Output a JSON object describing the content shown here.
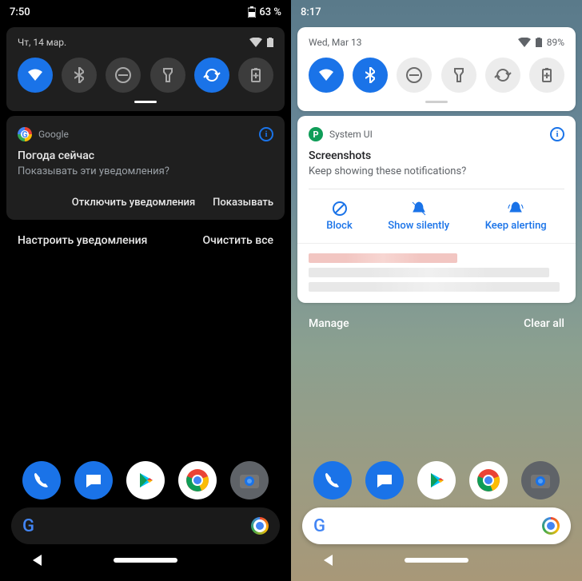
{
  "left": {
    "status": {
      "time": "7:50",
      "battery": "63 %"
    },
    "qs": {
      "date": "Чт, 14 мар.",
      "tiles": [
        {
          "name": "wifi",
          "on": true
        },
        {
          "name": "bluetooth",
          "on": false
        },
        {
          "name": "dnd",
          "on": false
        },
        {
          "name": "flashlight",
          "on": false
        },
        {
          "name": "autorotate",
          "on": true
        },
        {
          "name": "battery-saver",
          "on": false
        }
      ]
    },
    "notif": {
      "app": "Google",
      "title": "Погода сейчас",
      "body": "Показывать эти уведомления?",
      "action_deny": "Отключить уведомления",
      "action_allow": "Показывать"
    },
    "footer": {
      "manage": "Настроить уведомления",
      "clear": "Очистить все"
    },
    "dock": [
      "phone",
      "messages",
      "play",
      "chrome",
      "camera"
    ]
  },
  "right": {
    "status": {
      "time": "8:17",
      "battery": "89%"
    },
    "qs": {
      "date": "Wed, Mar 13",
      "tiles": [
        {
          "name": "wifi",
          "on": true
        },
        {
          "name": "bluetooth",
          "on": true
        },
        {
          "name": "dnd",
          "on": false
        },
        {
          "name": "flashlight",
          "on": false
        },
        {
          "name": "autorotate",
          "on": false
        },
        {
          "name": "battery-saver",
          "on": false
        }
      ]
    },
    "notif": {
      "app": "System UI",
      "title": "Screenshots",
      "body": "Keep showing these notifications?",
      "action_block": "Block",
      "action_silent": "Show silently",
      "action_alert": "Keep alerting"
    },
    "footer": {
      "manage": "Manage",
      "clear": "Clear all"
    },
    "dock": [
      "phone",
      "messages",
      "play",
      "chrome",
      "camera"
    ]
  },
  "colors": {
    "accent": "#1a73e8"
  }
}
